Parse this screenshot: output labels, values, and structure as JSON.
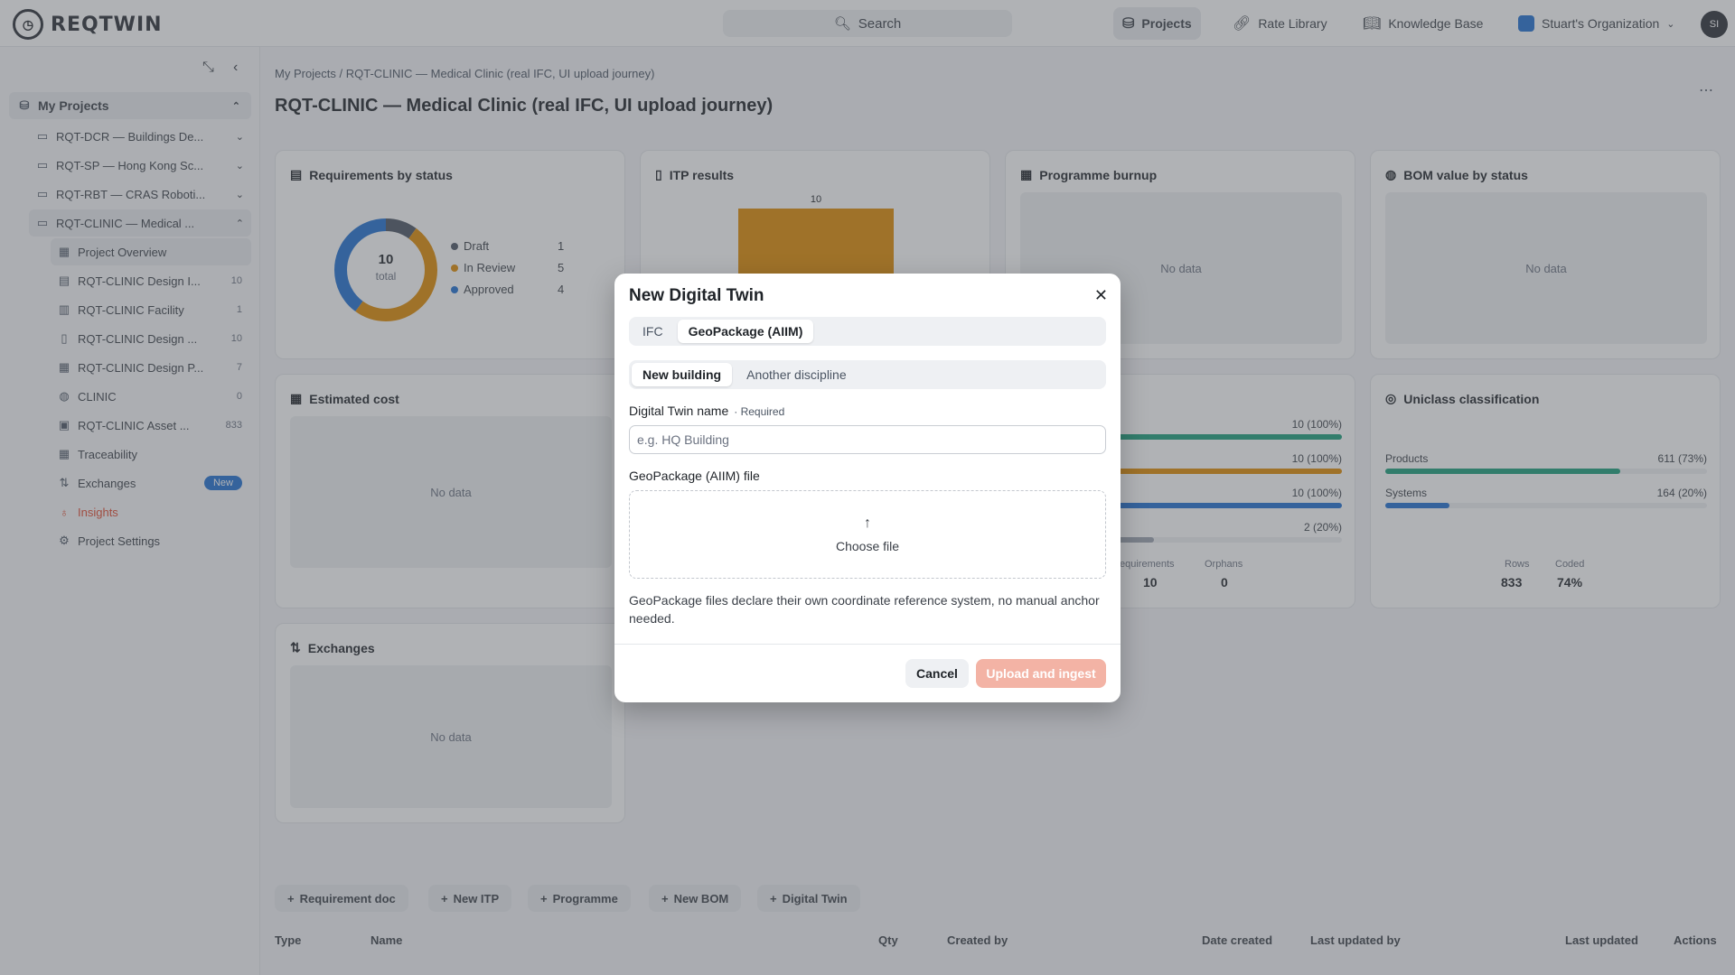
{
  "app": {
    "logo_text": "REQTWIN",
    "logo_icon": "clock-logo-icon"
  },
  "topbar": {
    "search_label": "Search",
    "nav": [
      {
        "label": "Projects",
        "icon": "database-icon",
        "active": true
      },
      {
        "label": "Rate Library",
        "icon": "link-icon",
        "active": false
      },
      {
        "label": "Knowledge Base",
        "icon": "book-icon",
        "active": false
      },
      {
        "label": "Stuart's Organization",
        "icon": "org-icon",
        "active": false
      }
    ],
    "avatar_initials": "SI"
  },
  "sidebar": {
    "root_label": "My Projects",
    "projects": [
      {
        "label": "RQT-DCR — Buildings De..."
      },
      {
        "label": "RQT-SP — Hong Kong Sc..."
      },
      {
        "label": "RQT-RBT — CRAS Roboti..."
      },
      {
        "label": "RQT-CLINIC — Medical ..."
      }
    ],
    "children": [
      {
        "label": "Project Overview",
        "count": ""
      },
      {
        "label": "RQT-CLINIC Design I...",
        "count": "10"
      },
      {
        "label": "RQT-CLINIC Facility",
        "count": "1"
      },
      {
        "label": "RQT-CLINIC Design ...",
        "count": "10"
      },
      {
        "label": "RQT-CLINIC Design P...",
        "count": "7"
      },
      {
        "label": "CLINIC",
        "count": "0"
      },
      {
        "label": "RQT-CLINIC Asset ...",
        "count": "833"
      },
      {
        "label": "Traceability",
        "count": ""
      },
      {
        "label": "Exchanges",
        "badge": "New"
      },
      {
        "label": "Insights",
        "count": ""
      },
      {
        "label": "Project Settings",
        "count": ""
      }
    ]
  },
  "main": {
    "breadcrumb_root": "My Projects",
    "breadcrumb_sep": " / ",
    "breadcrumb_current": "RQT-CLINIC — Medical Clinic (real IFC, UI upload journey)",
    "title": "RQT-CLINIC — Medical Clinic (real IFC, UI upload journey)",
    "no_data": "No data",
    "cards": {
      "requirements": {
        "title": "Requirements by status",
        "total_value": "10",
        "total_label": "total",
        "legend": [
          {
            "label": "Draft",
            "value": "1",
            "color": "#4b5563"
          },
          {
            "label": "In Review",
            "value": "5",
            "color": "#e08a00"
          },
          {
            "label": "Approved",
            "value": "4",
            "color": "#1f6fd1"
          }
        ]
      },
      "itp": {
        "title": "ITP results",
        "bar_value": "10",
        "bar_color": "#e08a00"
      },
      "programme": {
        "title": "Programme burnup"
      },
      "bom": {
        "title": "BOM value by status"
      },
      "cost": {
        "title": "Estimated cost"
      },
      "traceability": {
        "rows": [
          {
            "label": "10 (100%)",
            "fraction": 1.0,
            "color": "#1a9e7a"
          },
          {
            "label": "10 (100%)",
            "fraction": 1.0,
            "color": "#e08a00"
          },
          {
            "label": "10 (100%)",
            "fraction": 1.0,
            "color": "#1f6fd1"
          },
          {
            "label": "2 (20%)",
            "fraction": 0.2,
            "color": "#9ca3af"
          }
        ],
        "stats": [
          {
            "label": "equirements",
            "value": "10"
          },
          {
            "label": "Orphans",
            "value": "0"
          }
        ]
      },
      "uniclass": {
        "title": "Uniclass classification",
        "rows": [
          {
            "label": "Products",
            "value": "611 (73%)",
            "fraction": 0.73,
            "color": "#1a9e7a"
          },
          {
            "label": "Systems",
            "value": "164 (20%)",
            "fraction": 0.2,
            "color": "#1f6fd1"
          }
        ],
        "stats": [
          {
            "label": "Rows",
            "value": "833"
          },
          {
            "label": "Coded",
            "value": "74%"
          }
        ]
      },
      "exchanges": {
        "title": "Exchanges"
      }
    },
    "toolbar": [
      {
        "label": "Requirement doc"
      },
      {
        "label": "New ITP"
      },
      {
        "label": "Programme"
      },
      {
        "label": "New BOM"
      },
      {
        "label": "Digital Twin"
      }
    ],
    "table_headers": [
      "Type",
      "Name",
      "Qty",
      "Created by",
      "Date created",
      "Last updated by",
      "Last updated",
      "Actions"
    ]
  },
  "modal": {
    "title": "New Digital Twin",
    "format_tabs": [
      {
        "label": "IFC",
        "active": false
      },
      {
        "label": "GeoPackage (AIIM)",
        "active": true
      }
    ],
    "mode_tabs": [
      {
        "label": "New building",
        "active": true
      },
      {
        "label": "Another discipline",
        "active": false
      }
    ],
    "name_label": "Digital Twin name",
    "name_required": "· Required",
    "name_placeholder": "e.g. HQ Building",
    "name_value": "",
    "file_label": "GeoPackage (AIIM) file",
    "file_cta": "Choose file",
    "help_text": "GeoPackage files declare their own coordinate reference system, no manual anchor needed.",
    "cancel_label": "Cancel",
    "submit_label": "Upload and ingest"
  }
}
